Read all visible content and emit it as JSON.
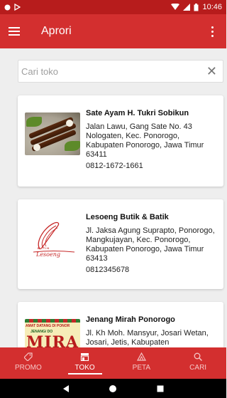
{
  "status_bar": {
    "time": "10:46"
  },
  "app_bar": {
    "title": "Aprori"
  },
  "search": {
    "placeholder": "Cari toko",
    "value": ""
  },
  "stores": [
    {
      "name": "Sate Ayam H. Tukri Sobikun",
      "address": "Jalan Lawu, Gang Sate No. 43 Nologaten, Kec. Ponorogo, Kabupaten Ponorogo, Jawa Timur 63411",
      "phone": "0812-1672-1661"
    },
    {
      "name": "Lesoeng Butik & Batik",
      "address": "Jl. Jaksa Agung Suprapto, Ponorogo, Mangkujayan, Kec. Ponorogo, Kabupaten Ponorogo, Jawa Timur 63413",
      "phone": "0812345678",
      "logo_text": "Lesoeng",
      "logo_sub": "B A T I K"
    },
    {
      "name": "Jenang Mirah Ponorogo",
      "address": "Jl. Kh Moh. Mansyur, Josari Wetan, Josari, Jetis, Kabupaten",
      "banner_line1": "AMAT DATANG DI PONOR",
      "banner_line2": "JENANG/ DO",
      "banner_word": "MIRA"
    }
  ],
  "bottom_nav": [
    {
      "label": "PROMO",
      "icon": "tag-icon",
      "active": false
    },
    {
      "label": "TOKO",
      "icon": "store-icon",
      "active": true
    },
    {
      "label": "PETA",
      "icon": "map-icon",
      "active": false
    },
    {
      "label": "CARI",
      "icon": "search-icon",
      "active": false
    }
  ],
  "colors": {
    "primary": "#d32f2f",
    "status_bar": "#b71c1c",
    "background": "#eeeeee"
  }
}
